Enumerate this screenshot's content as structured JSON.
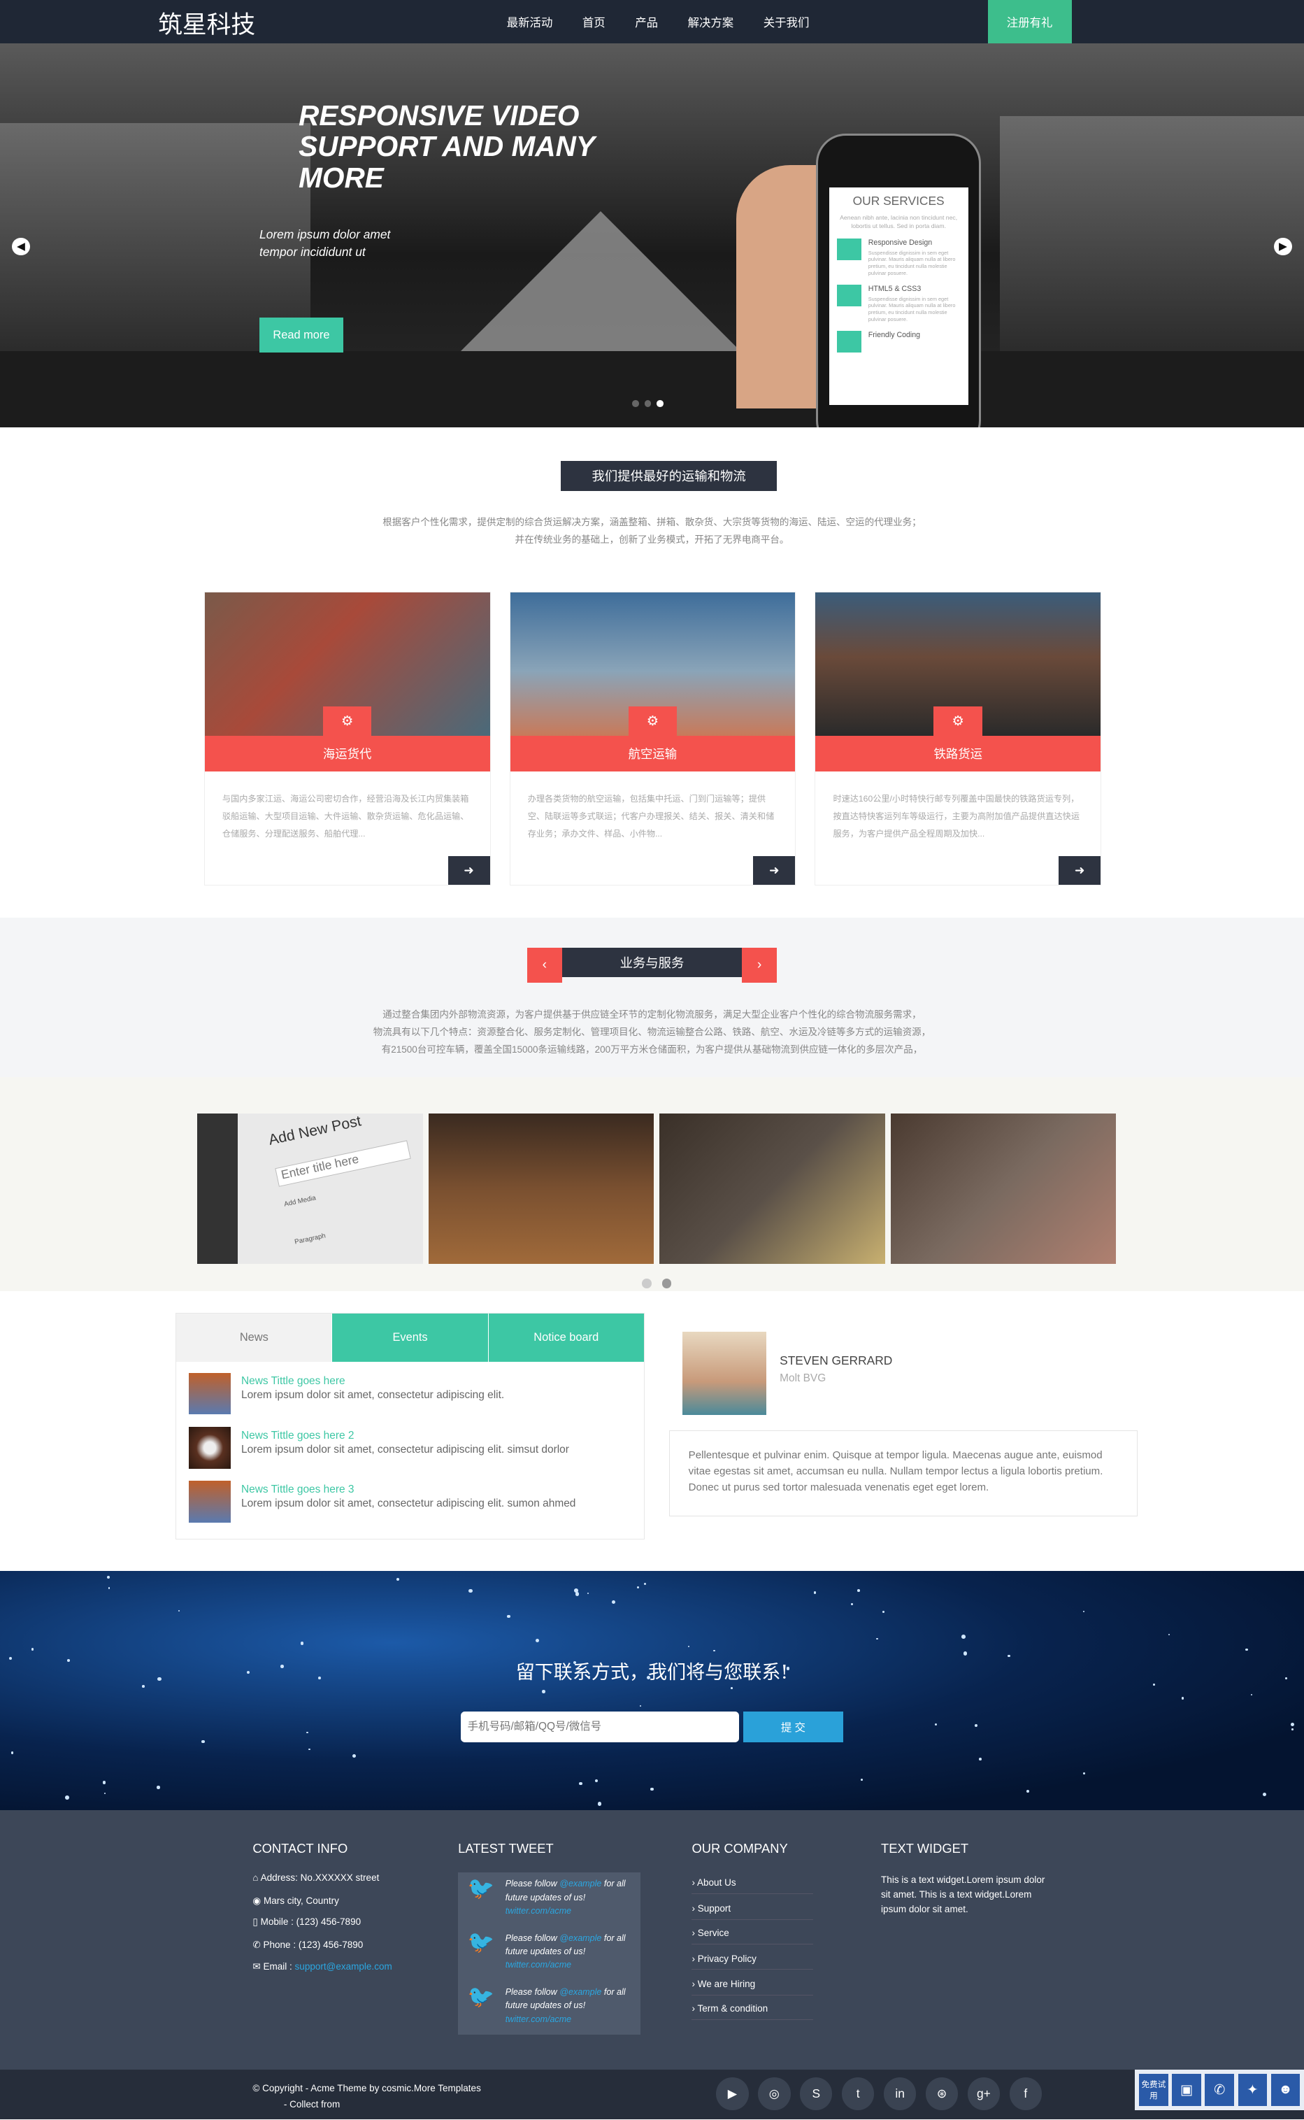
{
  "header": {
    "logo": "筑星科技",
    "nav": [
      "最新活动",
      "首页",
      "产品",
      "解决方案",
      "关于我们"
    ],
    "register": "注册有礼"
  },
  "hero": {
    "title": "RESPONSIVE VIDEO SUPPORT AND MANY MORE",
    "subtitle": "Lorem ipsum dolor amet tempor incididunt ut",
    "button": "Read more",
    "phone": {
      "title": "OUR SERVICES",
      "text": "Aenean nibh ante, lacinia non tincidunt nec, lobortis ut tellus. Sed in porta diam.",
      "items": [
        {
          "title": "Responsive Design",
          "text": "Suspendisse dignissim in sem eget pulvinar. Mauris aliquam nulla at libero pretium, eu tincidunt nulla molestie pulvinar posuere."
        },
        {
          "title": "HTML5 & CSS3",
          "text": "Suspendisse dignissim in sem eget pulvinar. Mauris aliquam nulla at libero pretium, eu tincidunt nulla molestie pulvinar posuere."
        },
        {
          "title": "Friendly Coding",
          "text": ""
        }
      ]
    }
  },
  "section1": {
    "title": "我们提供最好的运输和物流",
    "intro1": "根据客户个性化需求，提供定制的综合货运解决方案，涵盖整箱、拼箱、散杂货、大宗货等货物的海运、陆运、空运的代理业务；",
    "intro2": "并在传统业务的基础上，创新了业务模式，开拓了无界电商平台。",
    "cards": [
      {
        "label": "海运货代",
        "text": "与国内多家江运、海运公司密切合作，经营沿海及长江内贸集装箱驳船运输、大型项目运输、大件运输、散杂货运输、危化品运输、仓储服务、分理配送服务、船舶代理..."
      },
      {
        "label": "航空运输",
        "text": "办理各类货物的航空运输，包括集中托运、门到门运输等；提供空、陆联运等多式联运；代客户办理报关、结关、报关、清关和储存业务；承办文件、样品、小件物..."
      },
      {
        "label": "铁路货运",
        "text": "时速达160公里/小时特快行邮专列覆盖中国最快的铁路货运专列，按直达特快客运列车等级运行，主要为高附加值产品提供直达快运服务，为客户提供产品全程周期及加快..."
      }
    ]
  },
  "section2": {
    "title": "业务与服务",
    "p1": "通过整合集团内外部物流资源，为客户提供基于供应链全环节的定制化物流服务，满足大型企业客户个性化的综合物流服务需求，",
    "p2": "物流具有以下几个特点：资源整合化、服务定制化、管理项目化、物流运输整合公路、铁路、航空、水运及冷链等多方式的运输资源，",
    "p3": "有21500台可控车辆，覆盖全国15000条运输线路，200万平方米仓储面积，为客户提供从基础物流到供应链一体化的多层次产品，"
  },
  "gallery": {
    "post_title": "Add New Post",
    "post_placeholder": "Enter title here",
    "add_media": "Add Media",
    "paragraph": "Paragraph"
  },
  "tabs": {
    "items": [
      "News",
      "Events",
      "Notice board"
    ],
    "news": [
      {
        "title": "News Tittle goes here",
        "text": "Lorem ipsum dolor sit amet, consectetur adipiscing elit."
      },
      {
        "title": "News Tittle goes here 2",
        "text": "Lorem ipsum dolor sit amet, consectetur adipiscing elit. simsut dorlor"
      },
      {
        "title": "News Tittle goes here 3",
        "text": "Lorem ipsum dolor sit amet, consectetur adipiscing elit. sumon ahmed"
      }
    ]
  },
  "testimonial": {
    "name": "STEVEN GERRARD",
    "role": "Molt BVG",
    "quote": "Pellentesque et pulvinar enim. Quisque at tempor ligula. Maecenas augue ante, euismod vitae egestas sit amet, accumsan eu nulla. Nullam tempor lectus a ligula lobortis pretium. Donec ut purus sed tortor malesuada venenatis eget eget lorem."
  },
  "contact": {
    "title": "留下联系方式，我们将与您联系!",
    "placeholder": "手机号码/邮箱/QQ号/微信号",
    "submit": "提 交"
  },
  "footer": {
    "contact": {
      "title": "CONTACT INFO",
      "address": "Address: No.XXXXXX street",
      "city": "Mars city, Country",
      "mobile": "Mobile : (123) 456-7890",
      "phone": "Phone : (123) 456-7890",
      "email_label": "Email : ",
      "email": "support@example.com"
    },
    "tweet": {
      "title": "LATEST TWEET",
      "pre": "Please follow ",
      "handle": "@example",
      "post": " for all future updates of us!",
      "link": "twitter.com/acme"
    },
    "company": {
      "title": "OUR COMPANY",
      "links": [
        "About Us",
        "Support",
        "Service",
        "Privacy Policy",
        "We are Hiring",
        "Term & condition"
      ]
    },
    "widget": {
      "title": "TEXT WIDGET",
      "text": "This is a text widget.Lorem ipsum dolor sit amet. This is a text widget.Lorem ipsum dolor sit amet."
    },
    "copyright": "© Copyright - Acme Theme by cosmic.More Templates",
    "collect": "- Collect from",
    "social": [
      "youtube-icon",
      "github-icon",
      "skype-icon",
      "twitter-icon",
      "linkedin-icon",
      "dribbble-icon",
      "google-plus-icon",
      "facebook-icon"
    ],
    "trial": "免费试用"
  },
  "colors": {
    "accent": "#3dc7a4",
    "red": "#f4524d",
    "dark": "#1f2735",
    "footer": "#3d4758"
  }
}
